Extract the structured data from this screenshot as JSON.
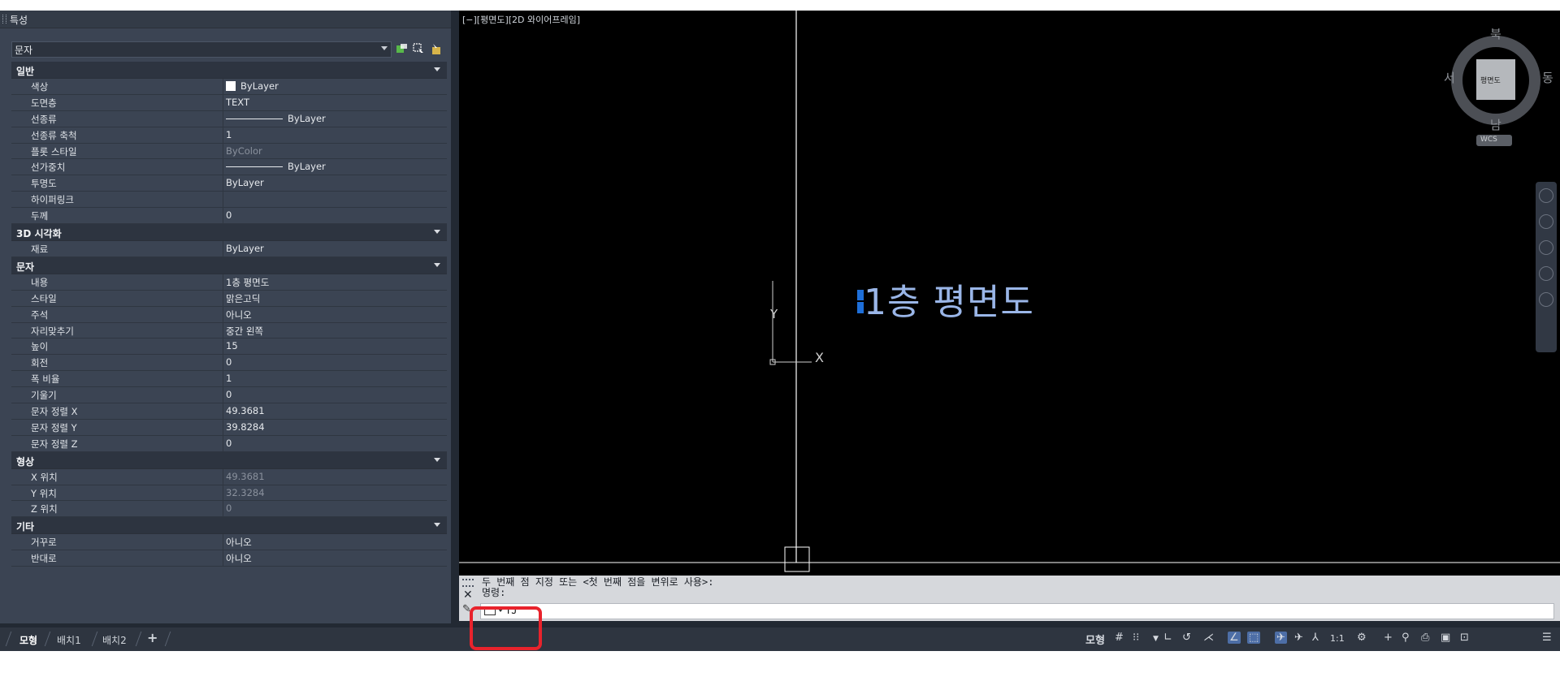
{
  "properties": {
    "title": "특성",
    "object_type": "문자",
    "categories": [
      {
        "label": "일반",
        "rows": [
          {
            "key": "색상",
            "value": "ByLayer",
            "kind": "swatch"
          },
          {
            "key": "도면층",
            "value": "TEXT"
          },
          {
            "key": "선종류",
            "value": "ByLayer",
            "kind": "line"
          },
          {
            "key": "선종류 축척",
            "value": "1"
          },
          {
            "key": "플롯 스타일",
            "value": "ByColor",
            "dim": true
          },
          {
            "key": "선가중치",
            "value": "ByLayer",
            "kind": "line"
          },
          {
            "key": "투명도",
            "value": "ByLayer"
          },
          {
            "key": "하이퍼링크",
            "value": ""
          },
          {
            "key": "두께",
            "value": "0"
          }
        ]
      },
      {
        "label": "3D 시각화",
        "rows": [
          {
            "key": "재료",
            "value": "ByLayer"
          }
        ]
      },
      {
        "label": "문자",
        "rows": [
          {
            "key": "내용",
            "value": "1층 평면도"
          },
          {
            "key": "스타일",
            "value": "맑은고딕"
          },
          {
            "key": "주석",
            "value": "아니오"
          },
          {
            "key": "자리맞추기",
            "value": "중간 왼쪽"
          },
          {
            "key": "높이",
            "value": "15"
          },
          {
            "key": "회전",
            "value": "0"
          },
          {
            "key": "폭 비율",
            "value": "1"
          },
          {
            "key": "기울기",
            "value": "0"
          },
          {
            "key": "문자 정렬 X",
            "value": "49.3681"
          },
          {
            "key": "문자 정렬 Y",
            "value": "39.8284"
          },
          {
            "key": "문자 정렬 Z",
            "value": "0"
          }
        ]
      },
      {
        "label": "형상",
        "rows": [
          {
            "key": "X 위치",
            "value": "49.3681",
            "dim": true
          },
          {
            "key": "Y 위치",
            "value": "32.3284",
            "dim": true
          },
          {
            "key": "Z 위치",
            "value": "0",
            "dim": true
          }
        ]
      },
      {
        "label": "기타",
        "rows": [
          {
            "key": "거꾸로",
            "value": "아니오"
          },
          {
            "key": "반대로",
            "value": "아니오"
          }
        ]
      }
    ]
  },
  "layout_tabs": [
    "모형",
    "배치1",
    "배치2",
    "+"
  ],
  "viewport": {
    "label": "[−][평면도][2D 와이어프레임]",
    "text_object": "1층 평면도",
    "ucs": {
      "y": "Y",
      "x": "X"
    },
    "viewcube": {
      "north": "북",
      "south": "남",
      "east": "동",
      "west": "서",
      "face": "평면도",
      "wcs": "WCS"
    }
  },
  "command_line": {
    "history_line1": "두 번째 점 지정 또는 <첫 번째 점을 변위로 사용>:",
    "history_line2": "명령:",
    "input_value": "TJ"
  },
  "status_bar": {
    "model_label": "모형",
    "scale": "1:1"
  },
  "colors": {
    "highlight": "#e8232c",
    "palette_bg": "#3b4453",
    "drawing_bg": "#000000",
    "text_object": "#9ab6e8",
    "grip": "#1e6fd9"
  }
}
